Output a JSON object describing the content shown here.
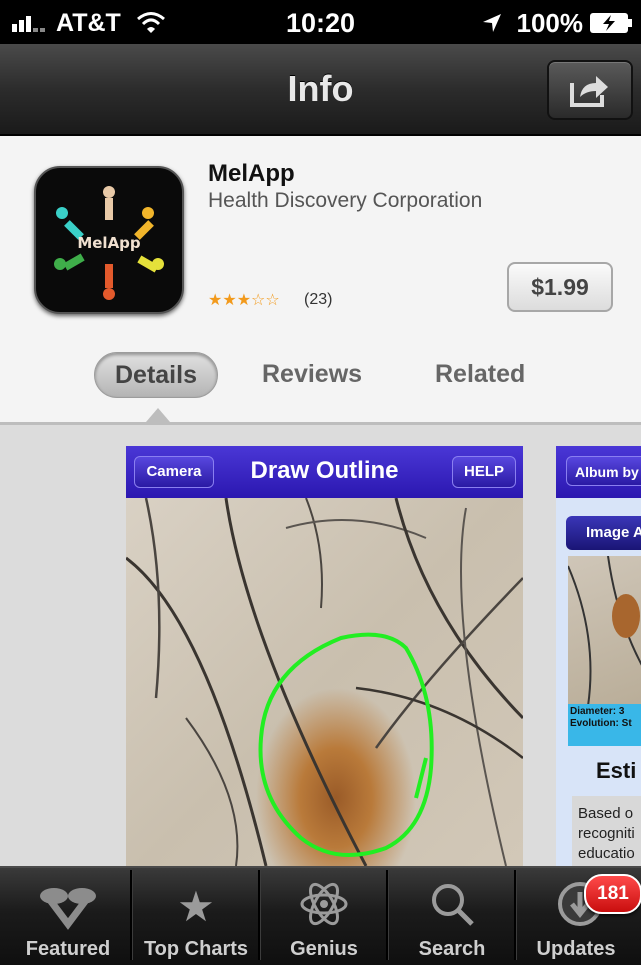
{
  "status_bar": {
    "carrier": "AT&T",
    "time": "10:20",
    "battery": "100%"
  },
  "nav": {
    "title": "Info",
    "share_icon": "share-icon"
  },
  "app": {
    "name": "MelApp",
    "developer": "Health Discovery Corporation",
    "icon_text": "MelApp",
    "rating": 2.5,
    "rating_stars": "★★★☆☆",
    "rating_count": "(23)",
    "price": "$1.99"
  },
  "segments": {
    "details": "Details",
    "reviews": "Reviews",
    "related": "Related"
  },
  "screenshot1": {
    "title": "Draw Outline",
    "left_button": "Camera",
    "right_button": "HELP"
  },
  "screenshot2": {
    "album_button": "Album by",
    "image_button": "Image A",
    "diameter": "Diameter: 3",
    "evolution": "Evolution: St",
    "heading": "Esti",
    "body_lines": [
      "Based o",
      "recogniti",
      "educatio"
    ]
  },
  "tabbar": {
    "items": [
      {
        "label": "Featured",
        "icon": "featured-icon"
      },
      {
        "label": "Top Charts",
        "icon": "star-icon"
      },
      {
        "label": "Genius",
        "icon": "atom-icon"
      },
      {
        "label": "Search",
        "icon": "search-icon"
      },
      {
        "label": "Updates",
        "icon": "download-icon"
      }
    ],
    "updates_badge": "181"
  }
}
